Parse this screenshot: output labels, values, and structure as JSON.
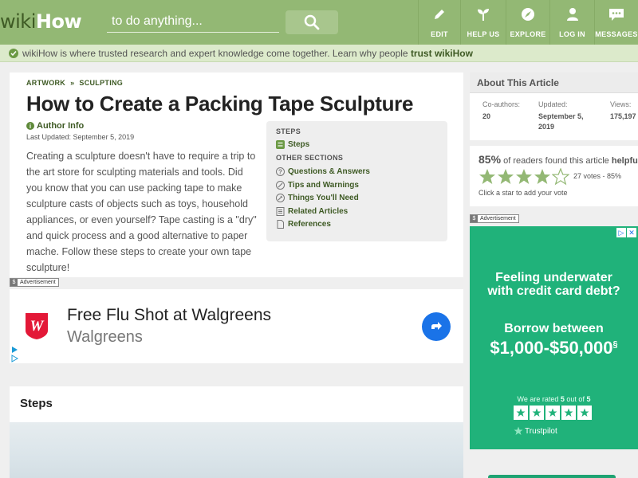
{
  "header": {
    "logo_wiki": "wiki",
    "logo_how": "How",
    "search_placeholder": "to do anything...",
    "nav": [
      {
        "label": "EDIT",
        "icon": "pencil-icon"
      },
      {
        "label": "HELP US",
        "icon": "sprout-icon"
      },
      {
        "label": "EXPLORE",
        "icon": "compass-icon"
      },
      {
        "label": "LOG IN",
        "icon": "user-icon"
      },
      {
        "label": "MESSAGES",
        "icon": "chat-icon"
      }
    ]
  },
  "trust_bar": {
    "text": "wikiHow is where trusted research and expert knowledge come together. Learn why people ",
    "link": "trust wikiHow"
  },
  "article": {
    "breadcrumb": [
      "ARTWORK",
      "SCULPTING"
    ],
    "breadcrumb_sep": "»",
    "title": "How to Create a Packing Tape Sculpture",
    "author_label": "Author Info",
    "last_updated": "Last Updated: September 5, 2019",
    "intro": "Creating a sculpture doesn't have to require a trip to the art store for sculpting materials and tools. Did you know that you can use packing tape to make sculpture casts of objects such as toys, household appliances, or even yourself? Tape casting is a \"dry\" and quick process and a good alternative to paper mache. Follow these steps to create your own tape sculpture!"
  },
  "toc": {
    "steps_heading": "STEPS",
    "steps_item": "Steps",
    "other_heading": "OTHER SECTIONS",
    "other_items": [
      {
        "label": "Questions & Answers",
        "icon": "question-icon"
      },
      {
        "label": "Tips and Warnings",
        "icon": "tips-icon"
      },
      {
        "label": "Things You'll Need",
        "icon": "tools-icon"
      },
      {
        "label": "Related Articles",
        "icon": "article-icon"
      },
      {
        "label": "References",
        "icon": "document-icon"
      }
    ]
  },
  "ad_label": "Advertisement",
  "ad_label_icon": "$",
  "ad": {
    "headline": "Free Flu Shot at Walgreens",
    "brand": "Walgreens"
  },
  "steps_section": {
    "heading": "Steps"
  },
  "about": {
    "heading": "About This Article",
    "coauthors_label": "Co-authors:",
    "coauthors_value": "20",
    "updated_label": "Updated:",
    "updated_value": "September 5, 2019",
    "views_label": "Views:",
    "views_value": "175,197"
  },
  "rating": {
    "percent": "85%",
    "text_before": "of readers found this article",
    "text_bold": "helpful.",
    "stars_filled": 4,
    "stars_total": 5,
    "votes": "27 votes - 85%",
    "hint": "Click a star to add your vote"
  },
  "side_ad": {
    "line1": "Feeling underwater",
    "line2": "with credit card debt?",
    "line3": "Borrow between",
    "line4": "$1,000-$50,000",
    "line4_sup": "§",
    "rated_prefix": "We are rated",
    "rated_value": "5",
    "rated_mid": "out of",
    "rated_total": "5",
    "trustpilot": "Trustpilot"
  },
  "colors": {
    "header_green": "#93b874",
    "link_green": "#3e5a24",
    "ad_green": "#20b27a",
    "ad_blue": "#1a73e8"
  }
}
